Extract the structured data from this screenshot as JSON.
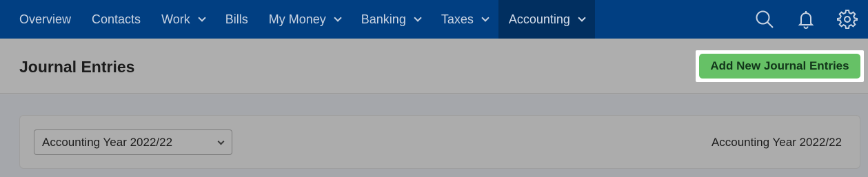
{
  "nav": {
    "items": [
      {
        "label": "Overview",
        "dropdown": false,
        "active": false
      },
      {
        "label": "Contacts",
        "dropdown": false,
        "active": false
      },
      {
        "label": "Work",
        "dropdown": true,
        "active": false
      },
      {
        "label": "Bills",
        "dropdown": false,
        "active": false
      },
      {
        "label": "My Money",
        "dropdown": true,
        "active": false
      },
      {
        "label": "Banking",
        "dropdown": true,
        "active": false
      },
      {
        "label": "Taxes",
        "dropdown": true,
        "active": false
      },
      {
        "label": "Accounting",
        "dropdown": true,
        "active": true
      }
    ],
    "icons": [
      "search-icon",
      "bell-icon",
      "gear-icon"
    ]
  },
  "header": {
    "title": "Journal Entries",
    "add_button_label": "Add New Journal Entries"
  },
  "filter": {
    "selected_year": "Accounting Year 2022/22",
    "year_display": "Accounting Year 2022/22"
  },
  "colors": {
    "nav_bg": "#013f82",
    "nav_active_bg": "#012f60",
    "button_green": "#66c166"
  }
}
